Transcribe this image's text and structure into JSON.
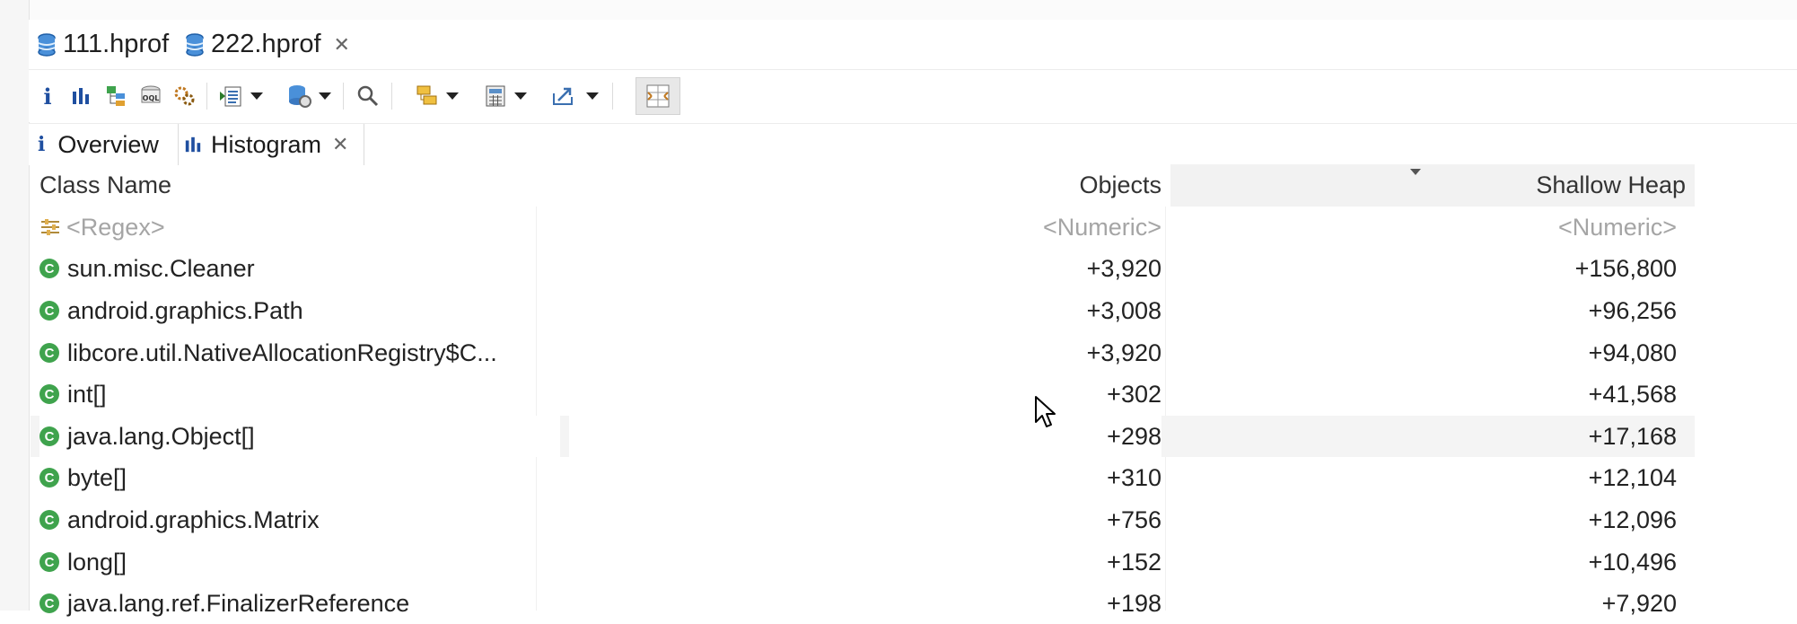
{
  "editor_tabs": [
    {
      "label": "111.hprof",
      "closable": false
    },
    {
      "label": "222.hprof",
      "closable": true,
      "active": true
    }
  ],
  "toolbar": {
    "icons": [
      "info-icon",
      "histogram-icon",
      "dominator-tree-icon",
      "oql-icon",
      "thread-overview-icon",
      "run-expert-report-icon",
      "query-browser-icon",
      "search-icon",
      "group-by-icon",
      "calculate-retained-icon",
      "export-icon",
      "compare-icon"
    ]
  },
  "view_tabs": [
    {
      "label": "Overview",
      "icon": "info-icon"
    },
    {
      "label": "Histogram",
      "icon": "histogram-icon",
      "active": true,
      "closable": true
    }
  ],
  "table": {
    "columns": [
      "Class Name",
      "Objects",
      "Shallow Heap"
    ],
    "sorted_column": "Shallow Heap",
    "filters": {
      "name": "<Regex>",
      "objects": "<Numeric>",
      "shallow": "<Numeric>"
    },
    "rows": [
      {
        "name": "sun.misc.Cleaner",
        "objects": "+3,920",
        "shallow": "+156,800"
      },
      {
        "name": "android.graphics.Path",
        "objects": "+3,008",
        "shallow": "+96,256"
      },
      {
        "name": "libcore.util.NativeAllocationRegistry$C...",
        "objects": "+3,920",
        "shallow": "+94,080"
      },
      {
        "name": "int[]",
        "objects": "+302",
        "shallow": "+41,568"
      },
      {
        "name": "java.lang.Object[]",
        "objects": "+298",
        "shallow": "+17,168",
        "highlighted": true
      },
      {
        "name": "byte[]",
        "objects": "+310",
        "shallow": "+12,104"
      },
      {
        "name": "android.graphics.Matrix",
        "objects": "+756",
        "shallow": "+12,096"
      },
      {
        "name": "long[]",
        "objects": "+152",
        "shallow": "+10,496"
      },
      {
        "name": "java.lang.ref.FinalizerReference",
        "objects": "+198",
        "shallow": "+7,920"
      }
    ]
  },
  "colors": {
    "class_icon": "#3fa34d",
    "heap_icon": "#2e86de",
    "filter_text": "#a5a5a5"
  }
}
